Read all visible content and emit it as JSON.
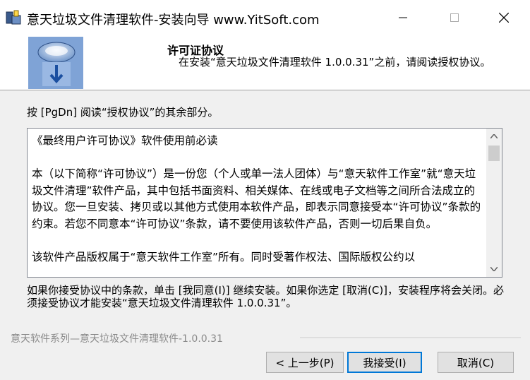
{
  "window": {
    "title": "意天垃圾文件清理软件-安装向导 www.YitSoft.com",
    "minimize_icon": "minimize-icon",
    "maximize_icon": "maximize-icon",
    "close_icon": "close-icon"
  },
  "header": {
    "title": "许可证协议",
    "subtitle": "在安装“意天垃圾文件清理软件 1.0.0.31”之前，请阅读授权协议。"
  },
  "instruction": "按 [PgDn] 阅读“授权协议”的其余部分。",
  "license": {
    "text": "《最终用户许可协议》软件使用前必读\n\n本（以下简称“许可协议”）是一份您（个人或单一法人团体）与“意天软件工作室”就“意天垃圾文件清理”软件产品，其中包括书面资料、相关媒体、在线或电子文档等之间所合法成立的协议。您一旦安装、拷贝或以其他方式使用本软件产品，即表示同意接受本“许可协议”条款的约束。若您不同意本“许可协议”条款，请不要使用该软件产品，否则一切后果自负。\n\n该软件产品版权属于“意天软件工作室”所有。同时受著作权法、国际版权公约以"
  },
  "notice": "如果你接受协议中的条款，单击 [我同意(I)] 继续安装。如果你选定 [取消(C)]，安装程序将会关闭。必须接受协议才能安装“意天垃圾文件清理软件 1.0.0.31”。",
  "footer": {
    "brand": "意天软件系列—意天垃圾文件清理软件-1.0.0.31"
  },
  "buttons": {
    "back": "< 上一步(P)",
    "accept": "我接受(I)",
    "cancel": "取消(C)"
  },
  "colors": {
    "default_button_border": "#0078d7",
    "background": "#f0f0f0"
  }
}
